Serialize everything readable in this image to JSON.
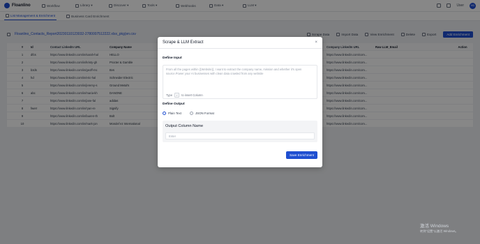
{
  "app": {
    "name": "Floanlino"
  },
  "nav": {
    "items": [
      {
        "label": "Workflow",
        "icon": "workflow-icon"
      },
      {
        "label": "Library ▾",
        "icon": "library-icon"
      },
      {
        "label": "Discover ▾",
        "icon": "discover-icon"
      },
      {
        "label": "Tools ▾",
        "icon": "tools-icon"
      },
      {
        "label": "Webhooks",
        "icon": "webhook-icon"
      },
      {
        "label": "Data ▾",
        "icon": "data-icon"
      },
      {
        "label": "LLM ▾",
        "icon": "llm-icon"
      }
    ],
    "user_label": "User",
    "avatar_initials": "HD"
  },
  "subtabs": [
    {
      "label": "List Management & Enrichment",
      "active": true
    },
    {
      "label": "Business Card Enrichment",
      "active": false
    }
  ],
  "toolbar": {
    "file_title": "Floanlino_Contacts_Report20230110123032-2780007512222.xlsx_pkg(en.csv",
    "tools": [
      "Scrape Data",
      "Import Data",
      "View Enrichment",
      "Delete",
      "Export"
    ],
    "add_button": "Add Enrichment"
  },
  "table": {
    "headers": [
      "",
      "#",
      "Id",
      "Contact LinkedIn URL",
      "Company Name",
      "",
      "Company LinkedIn URL",
      "Raw LLM_Email",
      "",
      "Action"
    ],
    "rows": [
      [
        "1",
        "dfcs",
        "https://www.linkedin.com/in/sarah-hal",
        "HELLO",
        "https://www.linkedin.com/com..."
      ],
      [
        "2",
        "",
        "https://www.linkedin.com/in/kristy-gh",
        "Procter & Gamble",
        "https://www.linkedin.com/com..."
      ],
      [
        "3",
        "bzds",
        "https://www.linkedin.com/in/geoff-mc",
        "Bvs",
        "https://www.linkedin.com/com..."
      ],
      [
        "4",
        "hd",
        "https://www.linkedin.com/in/eric-hal",
        "Schneider Electric",
        "https://www.linkedin.com/com..."
      ],
      [
        "5",
        "",
        "https://www.linkedin.com/in/jeremy-s",
        "Ground Metal's",
        "https://www.linkedin.com/com..."
      ],
      [
        "6",
        "abc",
        "https://www.linkedin.com/in/maria-kh",
        "DANONE",
        "https://www.linkedin.com/com..."
      ],
      [
        "7",
        "",
        "https://www.linkedin.com/in/jane-fal",
        "adidas",
        "https://www.linkedin.com/com..."
      ],
      [
        "8",
        "fwerr",
        "https://www.linkedin.com/in/ryan-re",
        "Signify",
        "https://www.linkedin.com/com..."
      ],
      [
        "9",
        "",
        "https://www.linkedin.com/in/lauren-th",
        "Bolt",
        "https://www.linkedin.com/com..."
      ],
      [
        "10",
        "",
        "https://www.linkedin.com/in/mark-jon",
        "Mondel`ez International",
        "https://www.linkedin.com/com..."
      ]
    ]
  },
  "modal": {
    "title": "Scrape & LLM Extract",
    "close_glyph": "×",
    "define_input_label": "Define Input",
    "prompt_placeholder": "From all the pages within {{Website}}, I want to extract the company name, mission and whether it's open source.Power your AI businesses with clean data crawled from any website",
    "hint_type": "Type",
    "hint_key": "/",
    "hint_suffix": "to insert Column",
    "define_output_label": "Define Output",
    "output_options": [
      {
        "label": "Plain Text",
        "selected": true
      },
      {
        "label": "JSON Format",
        "selected": false
      }
    ],
    "output_column_title": "Output Column Name",
    "output_column_placeholder": "Enter",
    "save_button": "Save Enrichment"
  },
  "watermark": {
    "line1": "激活 Windows",
    "line2": "转到\"设置\"以激活 Windows。"
  }
}
